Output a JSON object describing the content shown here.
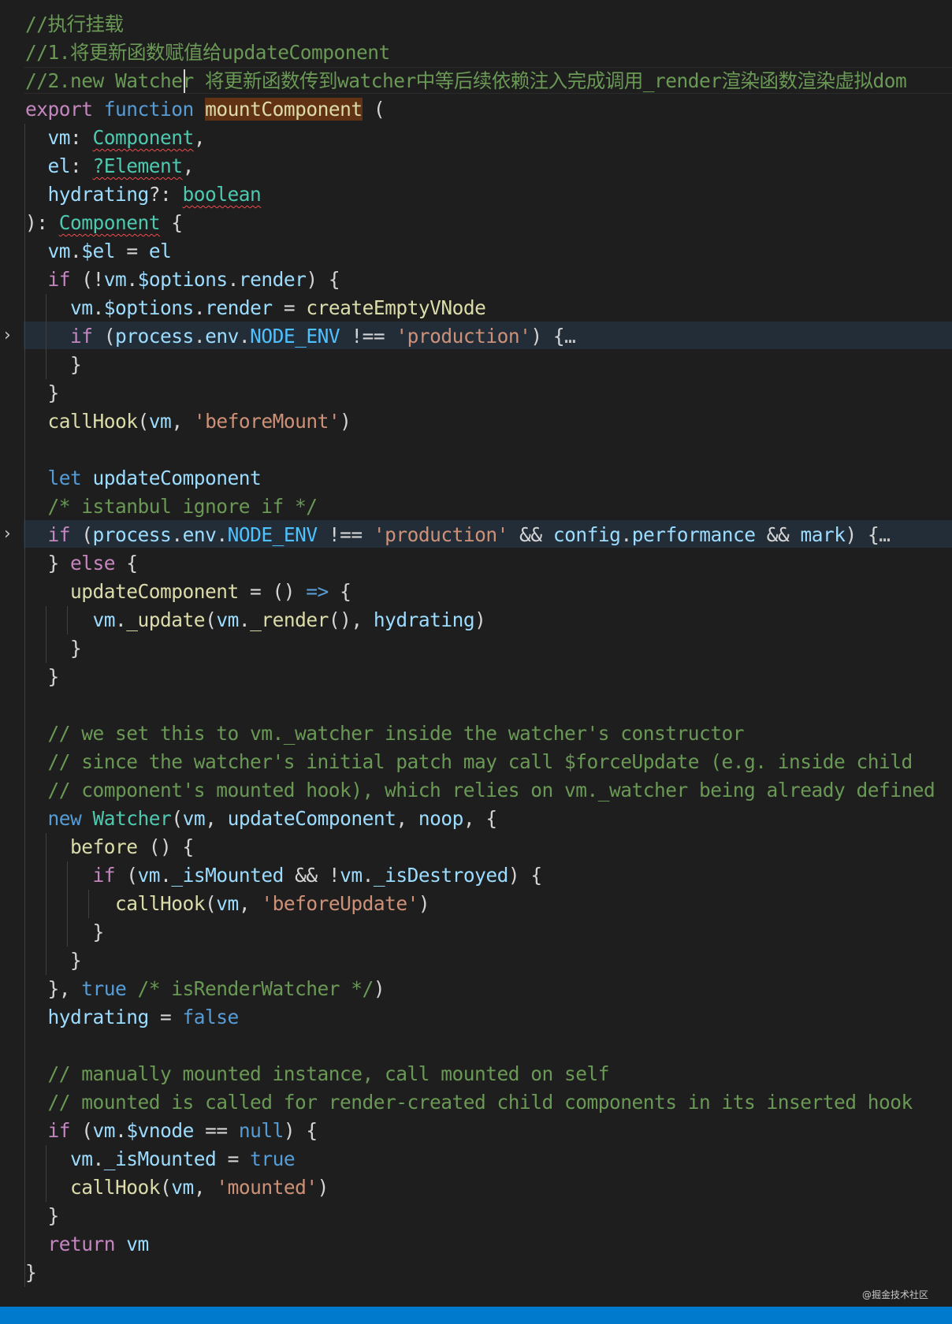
{
  "editor": {
    "colors": {
      "background": "#1e1e1e",
      "comment": "#6a9955",
      "keyword": "#569cd6",
      "control": "#c586c0",
      "type": "#4ec9b0",
      "function": "#dcdcaa",
      "variable": "#9cdcfe",
      "constant": "#4fc1ff",
      "string": "#ce9178",
      "status_bar": "#007acc",
      "fold_highlight": "#232d38",
      "match_highlight": "#613214",
      "error_squiggle": "#f14c4c"
    },
    "lines": [
      {
        "tokens": [
          {
            "t": "//执行挂载",
            "c": "comment"
          }
        ]
      },
      {
        "tokens": [
          {
            "t": "//1.将更新函数赋值给updateComponent",
            "c": "comment"
          }
        ]
      },
      {
        "current": true,
        "tokens": [
          {
            "t": "//2.new Watcher 将更新函数传到watcher中等后续依赖注入完成调用_render渲染函数渲染虚拟dom",
            "c": "comment"
          }
        ]
      },
      {
        "tokens": [
          {
            "t": "export",
            "c": "control"
          },
          {
            "t": " "
          },
          {
            "t": "function",
            "c": "keyword"
          },
          {
            "t": " "
          },
          {
            "t": "mountComponent",
            "c": "fnname"
          },
          {
            "t": " ("
          }
        ]
      },
      {
        "tokens": [
          {
            "t": "  "
          },
          {
            "t": "vm",
            "c": "var"
          },
          {
            "t": ": "
          },
          {
            "t": "Component",
            "c": "type",
            "err": true
          },
          {
            "t": ","
          }
        ]
      },
      {
        "tokens": [
          {
            "t": "  "
          },
          {
            "t": "el",
            "c": "var"
          },
          {
            "t": ": "
          },
          {
            "t": "?Element",
            "c": "type",
            "err": true
          },
          {
            "t": ","
          }
        ]
      },
      {
        "tokens": [
          {
            "t": "  "
          },
          {
            "t": "hydrating",
            "c": "var"
          },
          {
            "t": "?: "
          },
          {
            "t": "boolean",
            "c": "type",
            "err": true
          }
        ]
      },
      {
        "tokens": [
          {
            "t": "): "
          },
          {
            "t": "Component",
            "c": "type",
            "err": true
          },
          {
            "t": " {"
          }
        ]
      },
      {
        "tokens": [
          {
            "t": "  "
          },
          {
            "t": "vm",
            "c": "var"
          },
          {
            "t": "."
          },
          {
            "t": "$el",
            "c": "var"
          },
          {
            "t": " = "
          },
          {
            "t": "el",
            "c": "var"
          }
        ]
      },
      {
        "tokens": [
          {
            "t": "  "
          },
          {
            "t": "if",
            "c": "control"
          },
          {
            "t": " (!"
          },
          {
            "t": "vm",
            "c": "var"
          },
          {
            "t": "."
          },
          {
            "t": "$options",
            "c": "var"
          },
          {
            "t": "."
          },
          {
            "t": "render",
            "c": "var"
          },
          {
            "t": ") {"
          }
        ]
      },
      {
        "tokens": [
          {
            "t": "    "
          },
          {
            "t": "vm",
            "c": "var"
          },
          {
            "t": "."
          },
          {
            "t": "$options",
            "c": "var"
          },
          {
            "t": "."
          },
          {
            "t": "render",
            "c": "var"
          },
          {
            "t": " = "
          },
          {
            "t": "createEmptyVNode",
            "c": "func"
          }
        ]
      },
      {
        "folded": true,
        "tokens": [
          {
            "t": "    "
          },
          {
            "t": "if",
            "c": "control"
          },
          {
            "t": " ("
          },
          {
            "t": "process",
            "c": "var"
          },
          {
            "t": "."
          },
          {
            "t": "env",
            "c": "var"
          },
          {
            "t": "."
          },
          {
            "t": "NODE_ENV",
            "c": "const"
          },
          {
            "t": " !== "
          },
          {
            "t": "'production'",
            "c": "string"
          },
          {
            "t": ") {"
          },
          {
            "t": "…",
            "c": "fold"
          }
        ]
      },
      {
        "tokens": [
          {
            "t": "    }"
          }
        ]
      },
      {
        "tokens": [
          {
            "t": "  }"
          }
        ]
      },
      {
        "tokens": [
          {
            "t": "  "
          },
          {
            "t": "callHook",
            "c": "func"
          },
          {
            "t": "("
          },
          {
            "t": "vm",
            "c": "var"
          },
          {
            "t": ", "
          },
          {
            "t": "'beforeMount'",
            "c": "string"
          },
          {
            "t": ")"
          }
        ]
      },
      {
        "tokens": []
      },
      {
        "tokens": [
          {
            "t": "  "
          },
          {
            "t": "let",
            "c": "keyword"
          },
          {
            "t": " "
          },
          {
            "t": "updateComponent",
            "c": "var"
          }
        ]
      },
      {
        "tokens": [
          {
            "t": "  "
          },
          {
            "t": "/* istanbul ignore if */",
            "c": "comment"
          }
        ]
      },
      {
        "folded": true,
        "tokens": [
          {
            "t": "  "
          },
          {
            "t": "if",
            "c": "control"
          },
          {
            "t": " ("
          },
          {
            "t": "process",
            "c": "var"
          },
          {
            "t": "."
          },
          {
            "t": "env",
            "c": "var"
          },
          {
            "t": "."
          },
          {
            "t": "NODE_ENV",
            "c": "const"
          },
          {
            "t": " !== "
          },
          {
            "t": "'production'",
            "c": "string"
          },
          {
            "t": " && "
          },
          {
            "t": "config",
            "c": "var"
          },
          {
            "t": "."
          },
          {
            "t": "performance",
            "c": "var"
          },
          {
            "t": " && "
          },
          {
            "t": "mark",
            "c": "var"
          },
          {
            "t": ") {"
          },
          {
            "t": "…",
            "c": "fold"
          }
        ]
      },
      {
        "tokens": [
          {
            "t": "  } "
          },
          {
            "t": "else",
            "c": "control"
          },
          {
            "t": " {"
          }
        ]
      },
      {
        "tokens": [
          {
            "t": "    "
          },
          {
            "t": "updateComponent",
            "c": "func"
          },
          {
            "t": " = () "
          },
          {
            "t": "=>",
            "c": "keyword"
          },
          {
            "t": " {"
          }
        ]
      },
      {
        "tokens": [
          {
            "t": "      "
          },
          {
            "t": "vm",
            "c": "var"
          },
          {
            "t": "."
          },
          {
            "t": "_update",
            "c": "func"
          },
          {
            "t": "("
          },
          {
            "t": "vm",
            "c": "var"
          },
          {
            "t": "."
          },
          {
            "t": "_render",
            "c": "func"
          },
          {
            "t": "(), "
          },
          {
            "t": "hydrating",
            "c": "var"
          },
          {
            "t": ")"
          }
        ]
      },
      {
        "tokens": [
          {
            "t": "    }"
          }
        ]
      },
      {
        "tokens": [
          {
            "t": "  }"
          }
        ]
      },
      {
        "tokens": []
      },
      {
        "tokens": [
          {
            "t": "  "
          },
          {
            "t": "// we set this to vm._watcher inside the watcher's constructor",
            "c": "comment"
          }
        ]
      },
      {
        "tokens": [
          {
            "t": "  "
          },
          {
            "t": "// since the watcher's initial patch may call $forceUpdate (e.g. inside child",
            "c": "comment"
          }
        ]
      },
      {
        "tokens": [
          {
            "t": "  "
          },
          {
            "t": "// component's mounted hook), which relies on vm._watcher being already defined",
            "c": "comment"
          }
        ]
      },
      {
        "tokens": [
          {
            "t": "  "
          },
          {
            "t": "new",
            "c": "keyword"
          },
          {
            "t": " "
          },
          {
            "t": "Watcher",
            "c": "type"
          },
          {
            "t": "("
          },
          {
            "t": "vm",
            "c": "var"
          },
          {
            "t": ", "
          },
          {
            "t": "updateComponent",
            "c": "var"
          },
          {
            "t": ", "
          },
          {
            "t": "noop",
            "c": "var"
          },
          {
            "t": ", {"
          }
        ]
      },
      {
        "tokens": [
          {
            "t": "    "
          },
          {
            "t": "before",
            "c": "func"
          },
          {
            "t": " () {"
          }
        ]
      },
      {
        "tokens": [
          {
            "t": "      "
          },
          {
            "t": "if",
            "c": "control"
          },
          {
            "t": " ("
          },
          {
            "t": "vm",
            "c": "var"
          },
          {
            "t": "."
          },
          {
            "t": "_isMounted",
            "c": "var"
          },
          {
            "t": " && !"
          },
          {
            "t": "vm",
            "c": "var"
          },
          {
            "t": "."
          },
          {
            "t": "_isDestroyed",
            "c": "var"
          },
          {
            "t": ") {"
          }
        ]
      },
      {
        "tokens": [
          {
            "t": "        "
          },
          {
            "t": "callHook",
            "c": "func"
          },
          {
            "t": "("
          },
          {
            "t": "vm",
            "c": "var"
          },
          {
            "t": ", "
          },
          {
            "t": "'beforeUpdate'",
            "c": "string"
          },
          {
            "t": ")"
          }
        ]
      },
      {
        "tokens": [
          {
            "t": "      }"
          }
        ]
      },
      {
        "tokens": [
          {
            "t": "    }"
          }
        ]
      },
      {
        "tokens": [
          {
            "t": "  }, "
          },
          {
            "t": "true",
            "c": "keyword"
          },
          {
            "t": " "
          },
          {
            "t": "/* isRenderWatcher */",
            "c": "comment"
          },
          {
            "t": ")"
          }
        ]
      },
      {
        "tokens": [
          {
            "t": "  "
          },
          {
            "t": "hydrating",
            "c": "var"
          },
          {
            "t": " = "
          },
          {
            "t": "false",
            "c": "keyword"
          }
        ]
      },
      {
        "tokens": []
      },
      {
        "tokens": [
          {
            "t": "  "
          },
          {
            "t": "// manually mounted instance, call mounted on self",
            "c": "comment"
          }
        ]
      },
      {
        "tokens": [
          {
            "t": "  "
          },
          {
            "t": "// mounted is called for render-created child components in its inserted hook",
            "c": "comment"
          }
        ]
      },
      {
        "tokens": [
          {
            "t": "  "
          },
          {
            "t": "if",
            "c": "control"
          },
          {
            "t": " ("
          },
          {
            "t": "vm",
            "c": "var"
          },
          {
            "t": "."
          },
          {
            "t": "$vnode",
            "c": "var"
          },
          {
            "t": " == "
          },
          {
            "t": "null",
            "c": "keyword"
          },
          {
            "t": ") {"
          }
        ]
      },
      {
        "tokens": [
          {
            "t": "    "
          },
          {
            "t": "vm",
            "c": "var"
          },
          {
            "t": "."
          },
          {
            "t": "_isMounted",
            "c": "var"
          },
          {
            "t": " = "
          },
          {
            "t": "true",
            "c": "keyword"
          }
        ]
      },
      {
        "tokens": [
          {
            "t": "    "
          },
          {
            "t": "callHook",
            "c": "func"
          },
          {
            "t": "("
          },
          {
            "t": "vm",
            "c": "var"
          },
          {
            "t": ", "
          },
          {
            "t": "'mounted'",
            "c": "string"
          },
          {
            "t": ")"
          }
        ]
      },
      {
        "tokens": [
          {
            "t": "  }"
          }
        ]
      },
      {
        "tokens": [
          {
            "t": "  "
          },
          {
            "t": "return",
            "c": "control"
          },
          {
            "t": " "
          },
          {
            "t": "vm",
            "c": "var"
          }
        ]
      },
      {
        "tokens": [
          {
            "t": "}"
          }
        ]
      }
    ],
    "fold_icon_glyph": "›",
    "watermark": "@掘金技术社区"
  }
}
